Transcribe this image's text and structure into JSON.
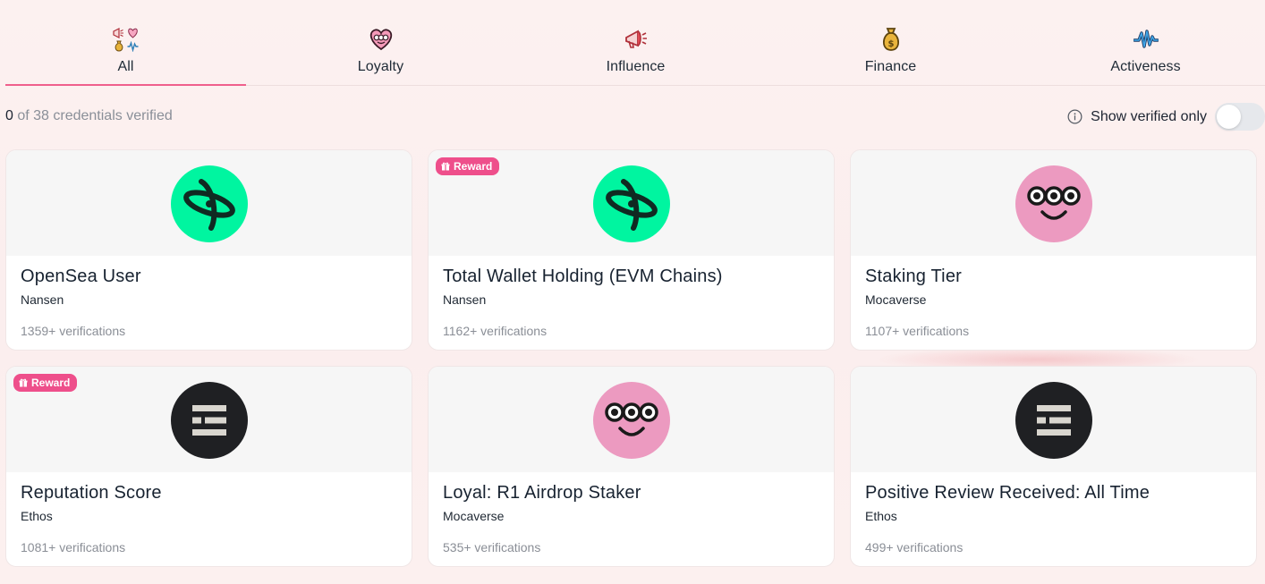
{
  "tabs": [
    {
      "label": "All",
      "icon": "category-mix-icon",
      "active": true
    },
    {
      "label": "Loyalty",
      "icon": "heart-face-icon",
      "active": false
    },
    {
      "label": "Influence",
      "icon": "megaphone-icon",
      "active": false
    },
    {
      "label": "Finance",
      "icon": "money-bag-icon",
      "active": false
    },
    {
      "label": "Activeness",
      "icon": "pulse-wave-icon",
      "active": false
    }
  ],
  "status": {
    "verified_count": "0",
    "rest": " of 38 credentials verified"
  },
  "toggle": {
    "label": "Show verified only",
    "on": false
  },
  "reward_label": "Reward",
  "colors": {
    "accent": "#ef5f8c",
    "reward_bg": "#ee4f8b",
    "nansen_logo_bg": "#00f5a0",
    "mocaverse_logo_bg": "#ec9ac0",
    "ethos_logo_bg": "#1f2023"
  },
  "cards": [
    {
      "title": "OpenSea User",
      "issuer": "Nansen",
      "count": "1359+ verifications",
      "logo": "nansen-logo",
      "reward": false
    },
    {
      "title": "Total Wallet Holding (EVM Chains)",
      "issuer": "Nansen",
      "count": "1162+ verifications",
      "logo": "nansen-logo",
      "reward": true
    },
    {
      "title": "Staking Tier",
      "issuer": "Mocaverse",
      "count": "1107+ verifications",
      "logo": "mocaverse-logo",
      "reward": false
    },
    {
      "title": "Reputation Score",
      "issuer": "Ethos",
      "count": "1081+ verifications",
      "logo": "ethos-logo",
      "reward": true
    },
    {
      "title": "Loyal: R1 Airdrop Staker",
      "issuer": "Mocaverse",
      "count": "535+ verifications",
      "logo": "mocaverse-logo",
      "reward": false
    },
    {
      "title": "Positive Review Received: All Time",
      "issuer": "Ethos",
      "count": "499+ verifications",
      "logo": "ethos-logo",
      "reward": false
    }
  ]
}
